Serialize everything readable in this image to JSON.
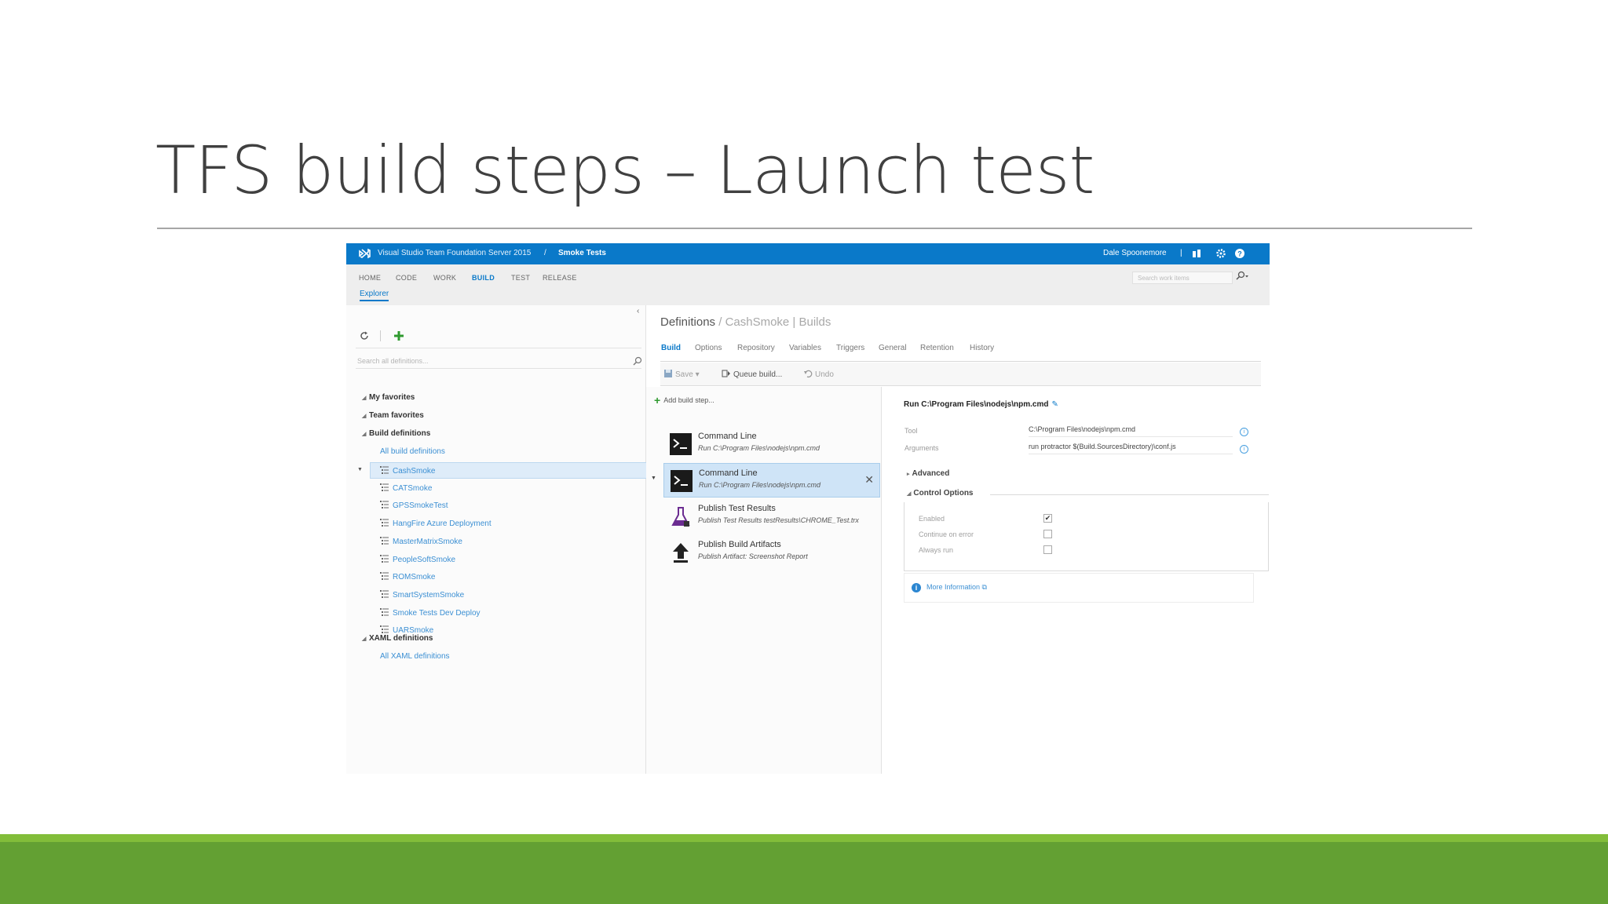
{
  "slide": {
    "title": "TFS build steps – Launch test",
    "colors": {
      "title": "#404040",
      "footer": "#63a033",
      "footer_stripe": "#82bd3a"
    }
  },
  "app": {
    "header": {
      "product": "Visual Studio Team Foundation Server 2015",
      "separator": "/",
      "project": "Smoke Tests",
      "user": "Dale Spoonemore",
      "divider": "|",
      "icons": [
        "people-icon",
        "gear-icon",
        "help-icon"
      ],
      "accent": "#0a79c9"
    },
    "nav": {
      "tabs": [
        "HOME",
        "CODE",
        "WORK",
        "BUILD",
        "TEST",
        "RELEASE"
      ],
      "active_tab": "BUILD",
      "subnav": "Explorer",
      "search_placeholder": "Search work items"
    },
    "left": {
      "collapse": "‹",
      "search_placeholder": "Search all definitions...",
      "sections": {
        "my_favorites": "My favorites",
        "team_favorites": "Team favorites",
        "build_definitions": "Build definitions",
        "all_build": "All build definitions",
        "xaml_definitions": "XAML definitions",
        "all_xaml": "All XAML definitions"
      },
      "definitions": [
        "CashSmoke",
        "CATSmoke",
        "GPSSmokeTest",
        "HangFire Azure Deployment",
        "MasterMatrixSmoke",
        "PeopleSoftSmoke",
        "ROMSmoke",
        "SmartSystemSmoke",
        "Smoke Tests Dev Deploy",
        "UARSmoke"
      ],
      "selected_definition": "CashSmoke"
    },
    "center": {
      "breadcrumb": {
        "root": "Definitions",
        "sep": " / ",
        "item": "CashSmoke",
        "sep2": " | ",
        "page": "Builds"
      },
      "tabs": [
        "Build",
        "Options",
        "Repository",
        "Variables",
        "Triggers",
        "General",
        "Retention",
        "History"
      ],
      "active_tab": "Build",
      "toolbar": {
        "save": "Save",
        "queue": "Queue build...",
        "undo": "Undo"
      },
      "add_step": "Add build step...",
      "steps": [
        {
          "title": "Command Line",
          "subtitle": "Run C:\\Program Files\\nodejs\\npm.cmd",
          "icon": "terminal-icon"
        },
        {
          "title": "Command Line",
          "subtitle": "Run C:\\Program Files\\nodejs\\npm.cmd",
          "icon": "terminal-icon"
        },
        {
          "title": "Publish Test Results",
          "subtitle": "Publish Test Results testResults\\CHROME_Test.trx",
          "icon": "flask-icon"
        },
        {
          "title": "Publish Build Artifacts",
          "subtitle": "Publish Artifact: Screenshot Report",
          "icon": "upload-arrow-icon"
        }
      ],
      "selected_step": 1
    },
    "right": {
      "title": "Run C:\\Program Files\\nodejs\\npm.cmd",
      "fields": [
        {
          "label": "Tool",
          "value": "C:\\Program Files\\nodejs\\npm.cmd"
        },
        {
          "label": "Arguments",
          "value": "run protractor $(Build.SourcesDirectory)\\conf.js"
        }
      ],
      "advanced": "Advanced",
      "control_options": "Control Options",
      "options": [
        {
          "label": "Enabled",
          "checked": true
        },
        {
          "label": "Continue on error",
          "checked": false
        },
        {
          "label": "Always run",
          "checked": false
        }
      ],
      "more_info": "More Information"
    }
  }
}
